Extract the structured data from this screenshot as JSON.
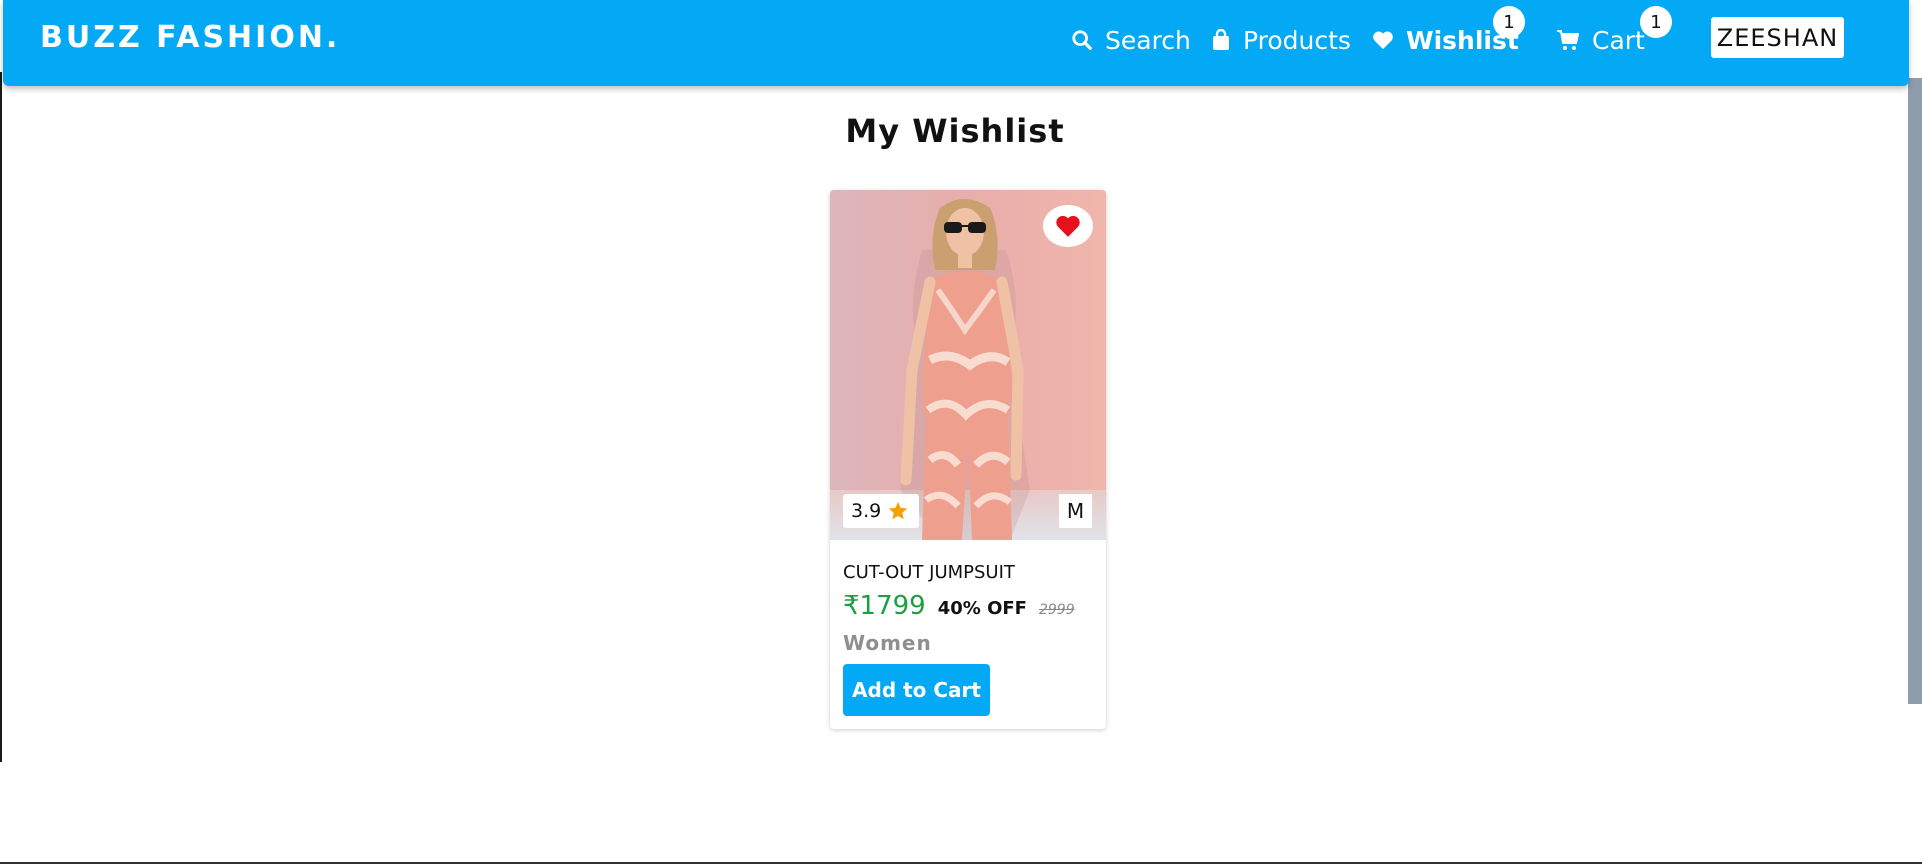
{
  "brand": {
    "name": "BUZZ FASHION."
  },
  "nav": {
    "search_label": "Search",
    "products_label": "Products",
    "wishlist_label": "Wishlist",
    "wishlist_count": "1",
    "cart_label": "Cart",
    "cart_count": "1",
    "user_name": "ZEESHAN"
  },
  "page": {
    "title": "My Wishlist"
  },
  "wishlist": {
    "items": [
      {
        "name": "CUT-OUT JUMPSUIT",
        "price": "₹1799",
        "discount": "40% OFF",
        "mrp": "2999",
        "category": "Women",
        "rating": "3.9",
        "size": "M",
        "add_to_cart_label": "Add to Cart"
      }
    ]
  },
  "colors": {
    "primary": "#03a9f4",
    "price_green": "#1e9e42",
    "heart_red": "#e8101b",
    "star_orange": "#f5a100"
  },
  "icons": [
    "search-icon",
    "shopping-bag-icon",
    "heart-icon",
    "cart-icon",
    "star-icon"
  ]
}
